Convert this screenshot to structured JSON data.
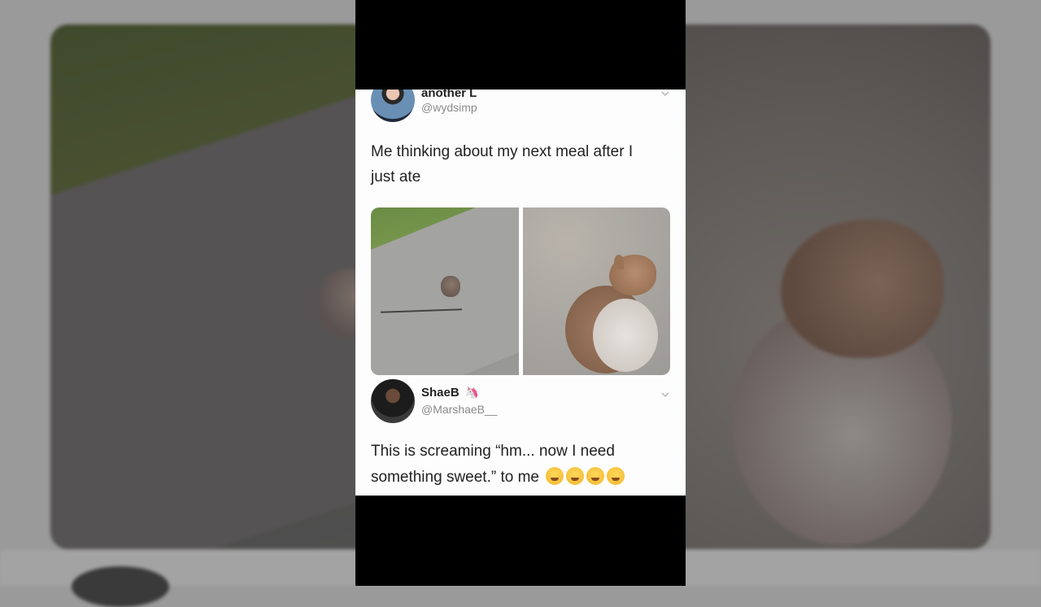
{
  "tweet1": {
    "name": "another L",
    "handle": "@wydsimp",
    "text_line1": "Me thinking about my next meal after I",
    "text_line2": "just ate"
  },
  "tweet2": {
    "name": "ShaeB",
    "name_emoji": "🦄",
    "handle": "@MarshaeB__",
    "text_line1": "This is screaming “hm... now I need",
    "text_line2": "something sweet.” to me"
  },
  "icons": {
    "chevron": "chevron-down-icon",
    "reaction_emojis": [
      "grinning-tears-emoji",
      "grinning-tears-emoji",
      "face-with-tears-of-joy-emoji",
      "face-with-tears-of-joy-emoji"
    ]
  },
  "colors": {
    "frame_bg": "#000000",
    "card_bg": "#fdfdfd",
    "handle_text": "#8a8a8a",
    "backdrop": "#9a9a9a"
  }
}
